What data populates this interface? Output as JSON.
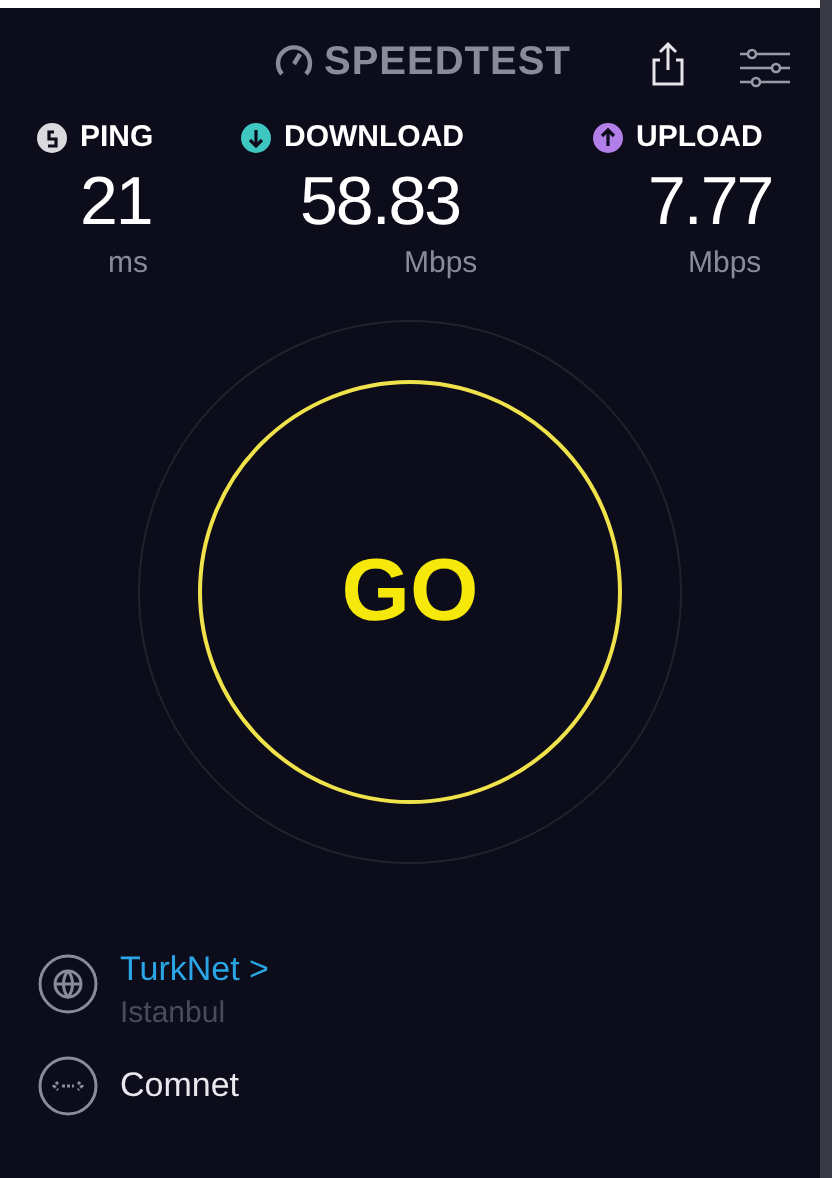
{
  "header": {
    "logo_text": "SPEEDTEST"
  },
  "metrics": [
    {
      "kind": "ping",
      "label": "PING",
      "value": "21",
      "unit": "ms",
      "color": "#d9d9de"
    },
    {
      "kind": "download",
      "label": "DOWNLOAD",
      "value": "58.83",
      "unit": "Mbps",
      "color": "#3ec6c0"
    },
    {
      "kind": "upload",
      "label": "UPLOAD",
      "value": "7.77",
      "unit": "Mbps",
      "color": "#b27ee8"
    }
  ],
  "go_button": {
    "label": "GO"
  },
  "provider": {
    "name": "TurkNet",
    "chevron": ">",
    "location": "Istanbul"
  },
  "host": {
    "name": "Comnet"
  }
}
